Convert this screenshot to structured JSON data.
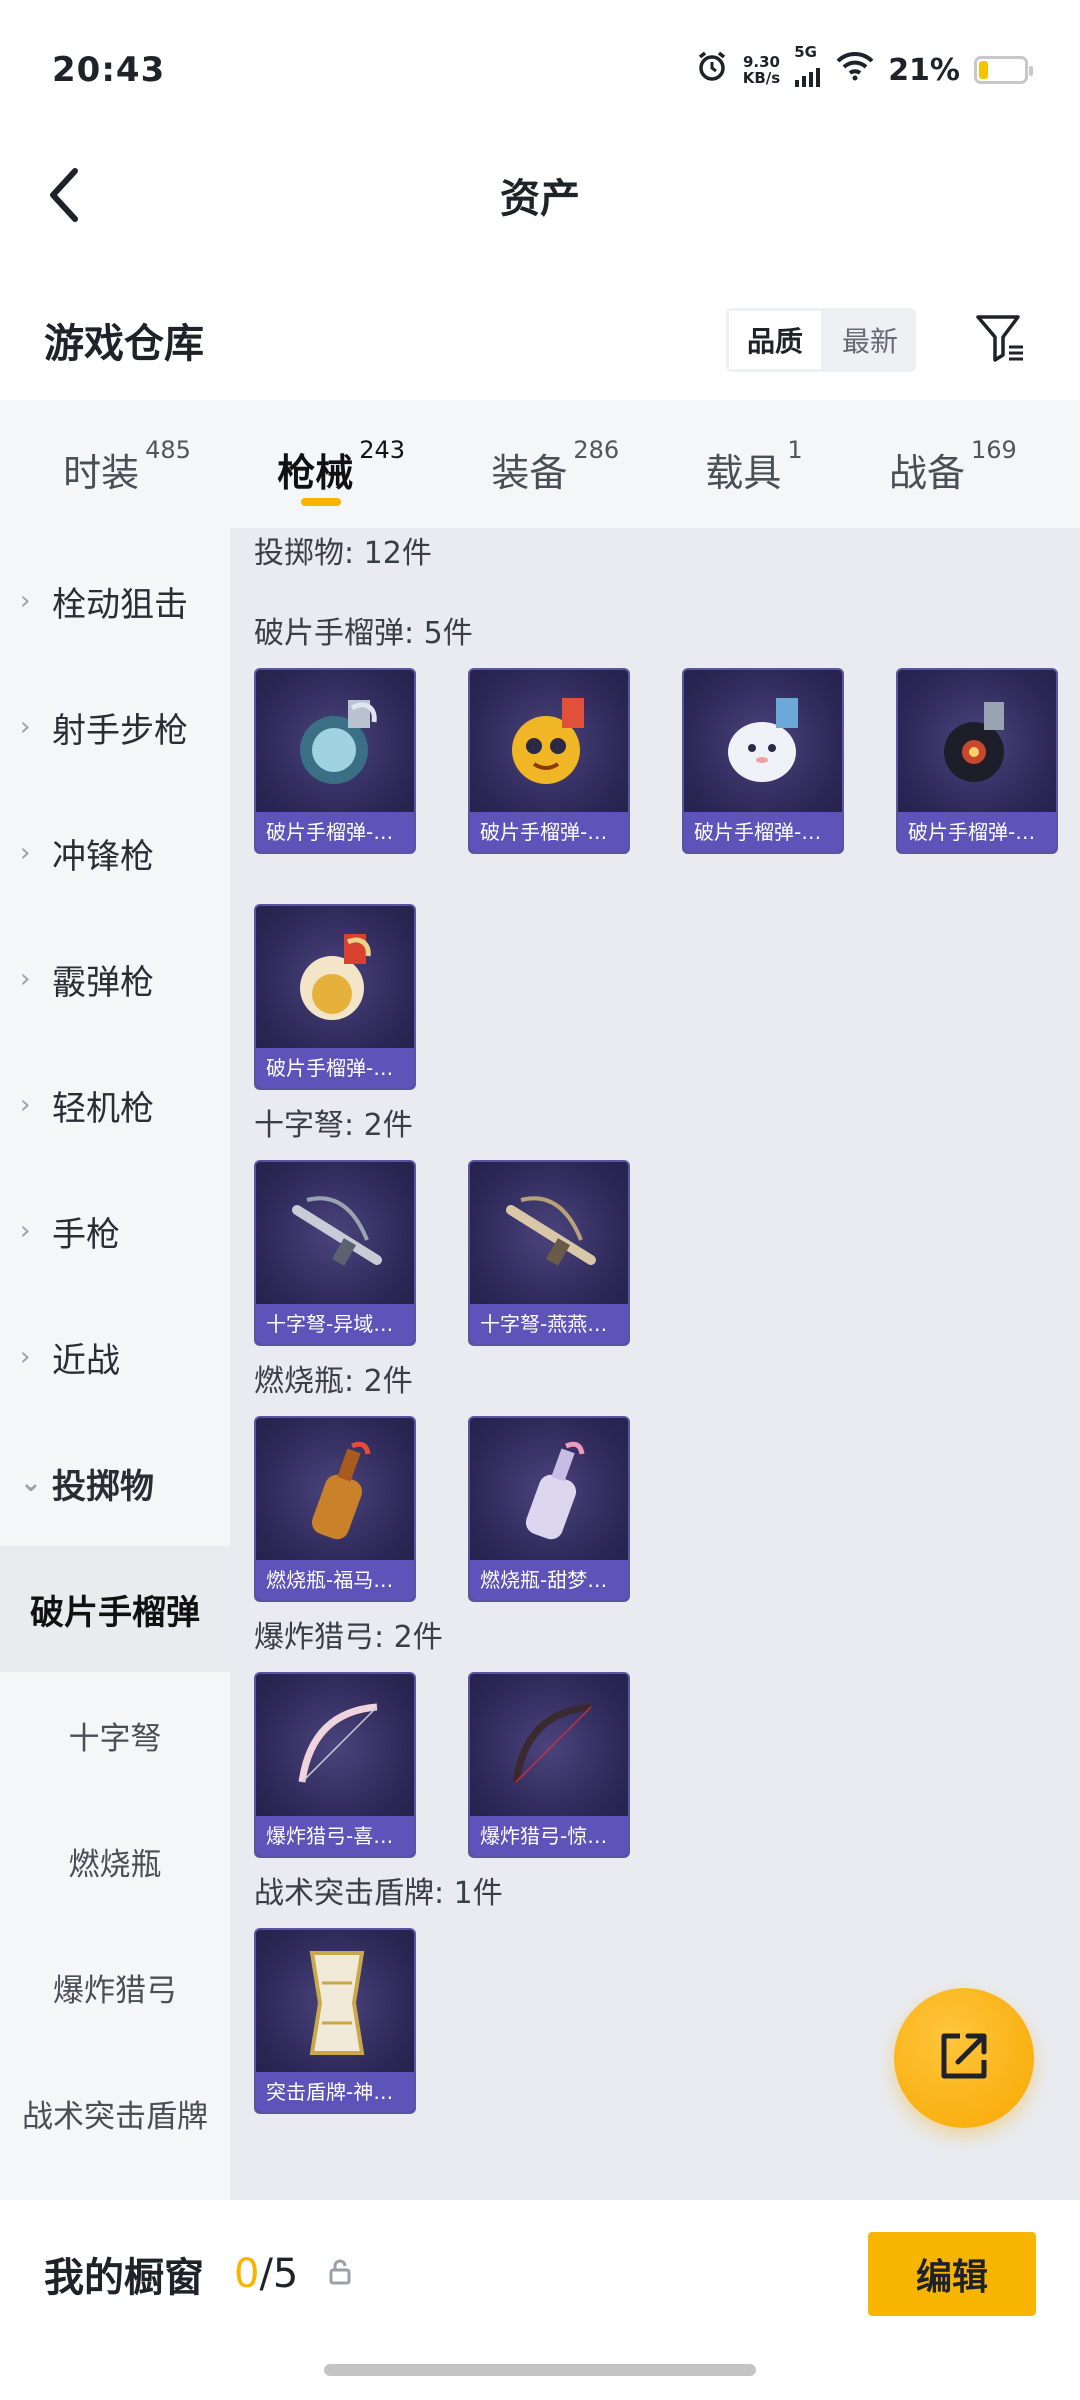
{
  "status_bar": {
    "time": "20:43",
    "net_speed_value": "9.30",
    "net_speed_unit": "KB/s",
    "network": "5G",
    "battery_percent": "21%",
    "battery_level": 0.21,
    "icons": [
      "alarm-icon",
      "signal-icon",
      "wifi-icon",
      "battery-icon"
    ]
  },
  "nav": {
    "title": "资产",
    "back_icon": "chevron-left-icon"
  },
  "warehouse": {
    "title": "游戏仓库",
    "sort_options": [
      "品质",
      "最新"
    ],
    "sort_active": "品质",
    "filter_icon": "filter-icon"
  },
  "category_tabs": [
    {
      "label": "时装",
      "count": "485"
    },
    {
      "label": "枪械",
      "count": "243",
      "active": true
    },
    {
      "label": "装备",
      "count": "286"
    },
    {
      "label": "载具",
      "count": "1"
    },
    {
      "label": "战备",
      "count": "169"
    }
  ],
  "sidebar": {
    "items": [
      {
        "label": "栓动狙击"
      },
      {
        "label": "射手步枪"
      },
      {
        "label": "冲锋枪"
      },
      {
        "label": "霰弹枪"
      },
      {
        "label": "轻机枪"
      },
      {
        "label": "手枪"
      },
      {
        "label": "近战"
      },
      {
        "label": "投掷物",
        "expanded": true
      }
    ],
    "sub_items": [
      {
        "label": "破片手榴弹",
        "active": true
      },
      {
        "label": "十字弩"
      },
      {
        "label": "燃烧瓶"
      },
      {
        "label": "爆炸猎弓"
      },
      {
        "label": "战术突击盾牌"
      }
    ]
  },
  "content": {
    "summary": "投掷物: 12件",
    "sections": [
      {
        "label": "破片手榴弹: 5件",
        "items": [
          "破片手榴弹-…",
          "破片手榴弹-…",
          "破片手榴弹-…",
          "破片手榴弹-…",
          "破片手榴弹-…"
        ]
      },
      {
        "label": "十字弩: 2件",
        "items": [
          "十字弩-异域…",
          "十字弩-燕燕…"
        ]
      },
      {
        "label": "燃烧瓶: 2件",
        "items": [
          "燃烧瓶-福马…",
          "燃烧瓶-甜梦…"
        ]
      },
      {
        "label": "爆炸猎弓: 2件",
        "items": [
          "爆炸猎弓-喜…",
          "爆炸猎弓-惊…"
        ]
      },
      {
        "label": "战术突击盾牌: 1件",
        "items": [
          "突击盾牌-神…"
        ]
      }
    ]
  },
  "fab": {
    "icon": "share-icon"
  },
  "bottom": {
    "title": "我的橱窗",
    "current": "0",
    "total": "/5",
    "lock_icon": "lock-icon",
    "edit_label": "编辑"
  }
}
